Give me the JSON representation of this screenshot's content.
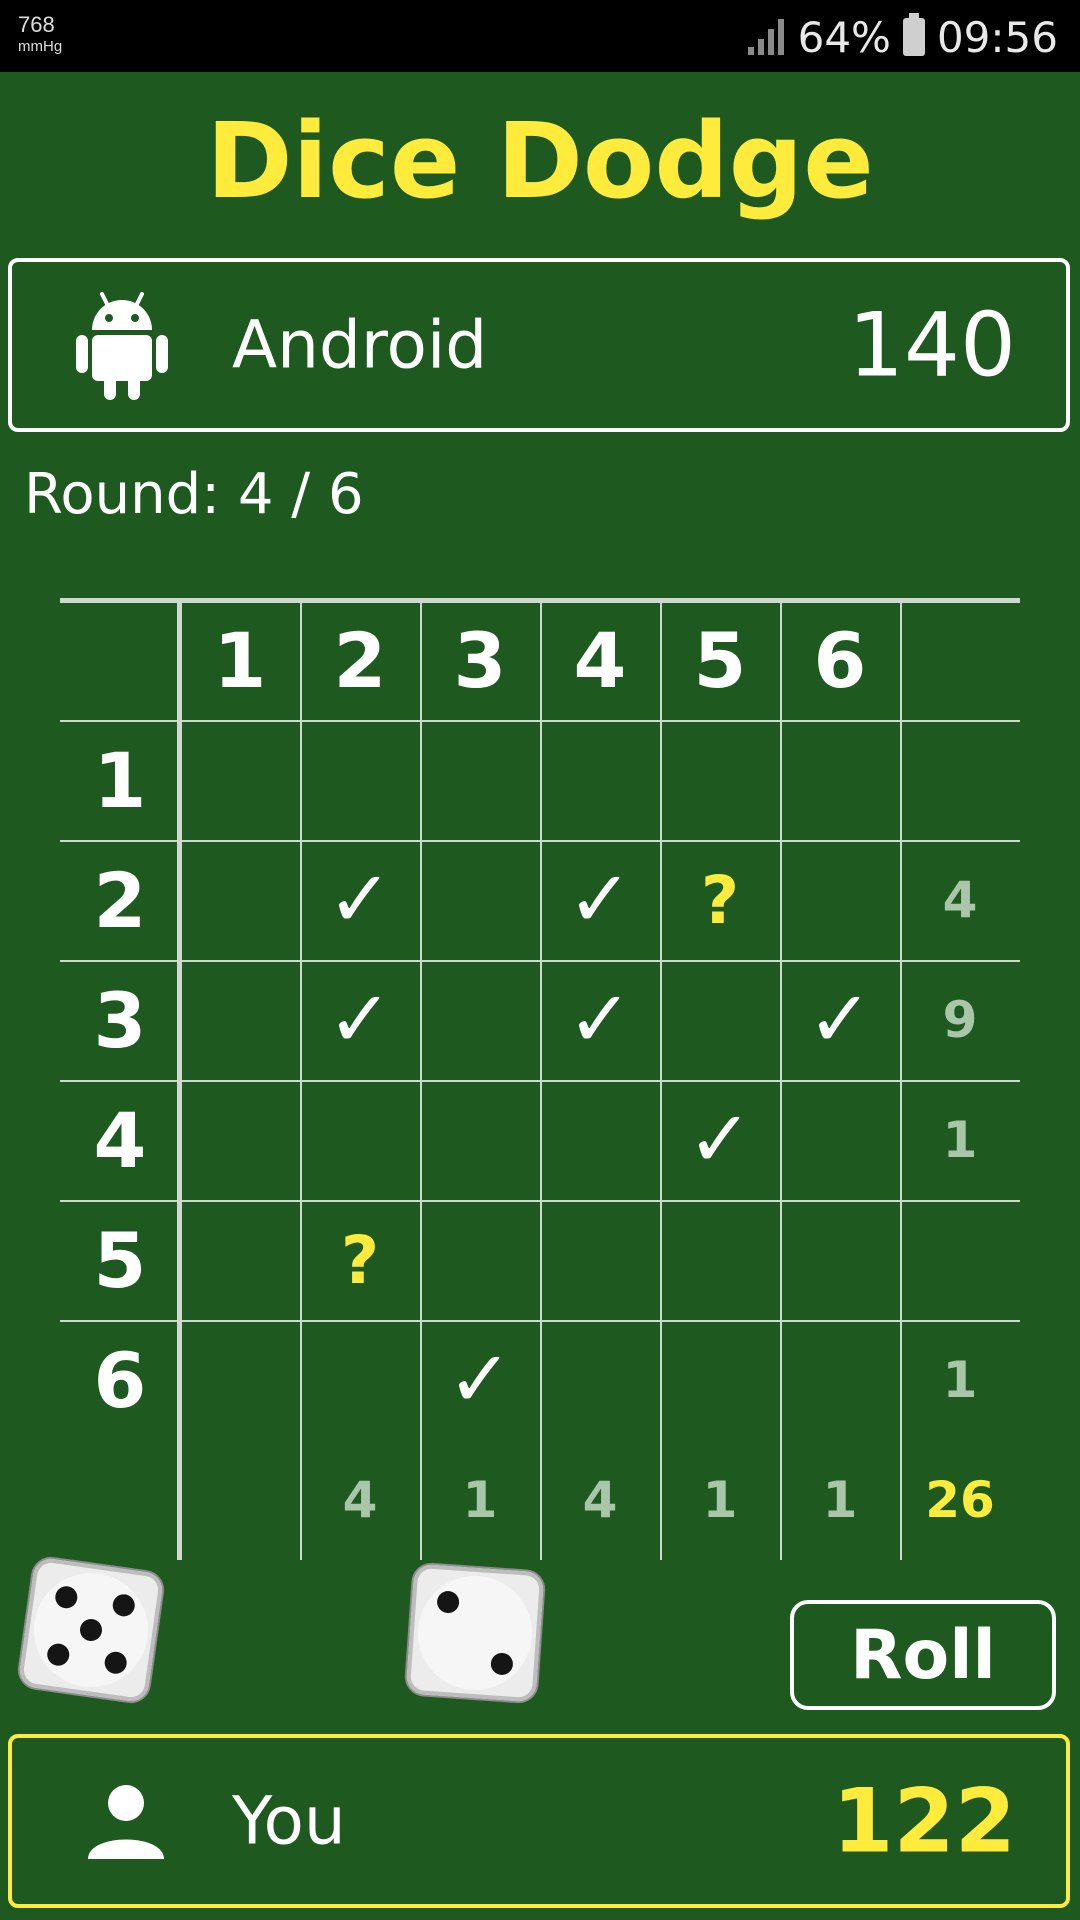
{
  "status_bar": {
    "pressure_value": "768",
    "pressure_unit": "mmHg",
    "battery_percent": "64%",
    "time": "09:56"
  },
  "title": "Dice Dodge",
  "opponent": {
    "name": "Android",
    "score": "140",
    "icon": "android-icon"
  },
  "round": {
    "label": "Round:",
    "value": "4 / 6"
  },
  "grid": {
    "column_headers": [
      "1",
      "2",
      "3",
      "4",
      "5",
      "6"
    ],
    "row_headers": [
      "1",
      "2",
      "3",
      "4",
      "5",
      "6"
    ],
    "cells": [
      [
        "",
        "",
        "",
        "",
        "",
        ""
      ],
      [
        "",
        "✓",
        "",
        "✓",
        "?",
        ""
      ],
      [
        "",
        "✓",
        "",
        "✓",
        "",
        "✓"
      ],
      [
        "",
        "",
        "",
        "",
        "✓",
        ""
      ],
      [
        "",
        "?",
        "",
        "",
        "",
        ""
      ],
      [
        "",
        "",
        "✓",
        "",
        "",
        ""
      ]
    ],
    "row_sums": [
      "",
      "4",
      "9",
      "1",
      "",
      "1"
    ],
    "column_sums": [
      "",
      "4",
      "1",
      "4",
      "1",
      "1"
    ],
    "total": "26"
  },
  "dice": [
    {
      "value": 5,
      "icon": "die-five-icon"
    },
    {
      "value": 2,
      "icon": "die-two-icon"
    }
  ],
  "roll_button": "Roll",
  "player": {
    "name": "You",
    "score": "122",
    "icon": "person-icon"
  },
  "colors": {
    "background": "#1e5a20",
    "accent": "#ffeb3b",
    "sum_text": "#a9c6a9"
  }
}
